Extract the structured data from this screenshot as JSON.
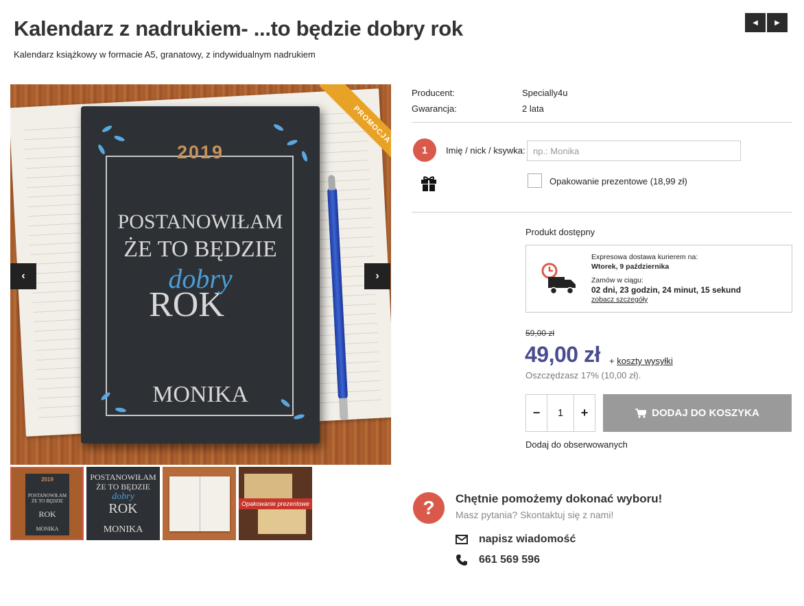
{
  "product": {
    "title": "Kalendarz z nadrukiem- ...to będzie dobry rok",
    "subtitle": "Kalendarz książkowy w formacie A5, granatowy, z indywidualnym nadrukiem",
    "promo_badge": "PROMOCJA"
  },
  "image": {
    "year": "2019",
    "line1": "POSTANOWIŁAM",
    "line2": "ŻE TO BĘDZIE",
    "line3": "dobry",
    "line4": "ROK",
    "name": "MONIKA",
    "thumb_gift_label": "Opakowanie prezentowe"
  },
  "specs": [
    {
      "key": "Producent:",
      "value": "Specially4u"
    },
    {
      "key": "Gwarancja:",
      "value": "2 lata"
    }
  ],
  "personalization": {
    "step": "1",
    "label": "Imię / nick / ksywka:",
    "placeholder": "np.: Monika",
    "gift_wrap_label": "Opakowanie prezentowe (18,99 zł)"
  },
  "availability": "Produkt dostępny",
  "delivery": {
    "line1": "Expresowa dostawa kurierem na:",
    "date": "Wtorek, 9 października",
    "line2": "Zamów w ciągu:",
    "countdown": "02 dni, 23 godzin, 24 minut, 15 sekund",
    "details_link": "zobacz szczegóły"
  },
  "pricing": {
    "old_price": "59,00 zł",
    "price": "49,00 zł",
    "shipping_plus": "+",
    "shipping_link": "koszty wysyłki",
    "savings": "Oszczędzasz 17% (10,00 zł)."
  },
  "cart": {
    "minus": "−",
    "quantity": "1",
    "plus": "+",
    "add_label": "DODAJ DO KOSZYKA",
    "watch_label": "Dodaj do obserwowanych"
  },
  "help": {
    "icon_text": "?",
    "title": "Chętnie pomożemy dokonać wyboru!",
    "subtitle": "Masz pytania? Skontaktuj się z nami!",
    "email_label": "napisz wiadomość",
    "phone": "661 569 596"
  },
  "colors": {
    "accent_red": "#d95a4b",
    "price_blue": "#4a4c8f",
    "button_gray": "#9a9a9a",
    "promo_orange": "#e8a225"
  }
}
